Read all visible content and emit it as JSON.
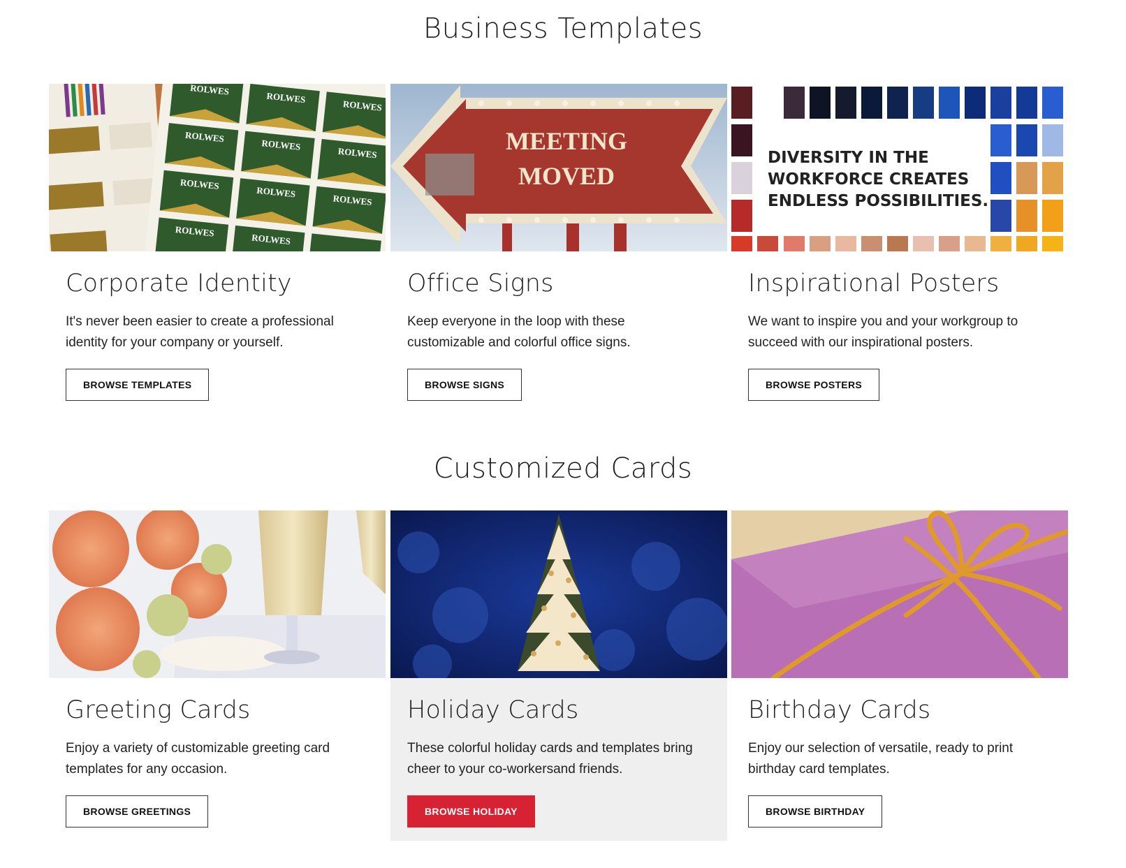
{
  "sections": {
    "business_title": "Business Templates",
    "cards_title": "Customized Cards"
  },
  "business_cards": [
    {
      "heading": "Corporate Identity",
      "description": "It's never been easier to create a professional identity for your company or yourself.",
      "button": "BROWSE TEMPLATES",
      "image_text": "ROLWES"
    },
    {
      "heading": "Office Signs",
      "description": "Keep everyone in the loop with these customizable and colorful office signs.",
      "button": "BROWSE SIGNS",
      "image_text_1": "MEETING",
      "image_text_2": "MOVED"
    },
    {
      "heading": "Inspirational Posters",
      "description": "We want to inspire you and your workgroup to succeed with our inspirational posters.",
      "button": "BROWSE POSTERS",
      "image_text_1": "DIVERSITY IN THE",
      "image_text_2": "WORKFORCE CREATES",
      "image_text_3": "ENDLESS POSSIBILITIES."
    }
  ],
  "custom_cards": [
    {
      "heading": "Greeting Cards",
      "description": "Enjoy a variety of customizable greeting card templates for any occasion.",
      "button": "BROWSE GREETINGS"
    },
    {
      "heading": "Holiday Cards",
      "description": "These colorful holiday cards and templates bring cheer to your co-workersand friends.",
      "button": "BROWSE HOLIDAY"
    },
    {
      "heading": "Birthday Cards",
      "description": "Enjoy our selection of versatile, ready to print birthday card templates.",
      "button": "BROWSE BIRTHDAY"
    }
  ],
  "colors": {
    "accent_red": "#d72234",
    "highlight_bg": "#efefef"
  }
}
